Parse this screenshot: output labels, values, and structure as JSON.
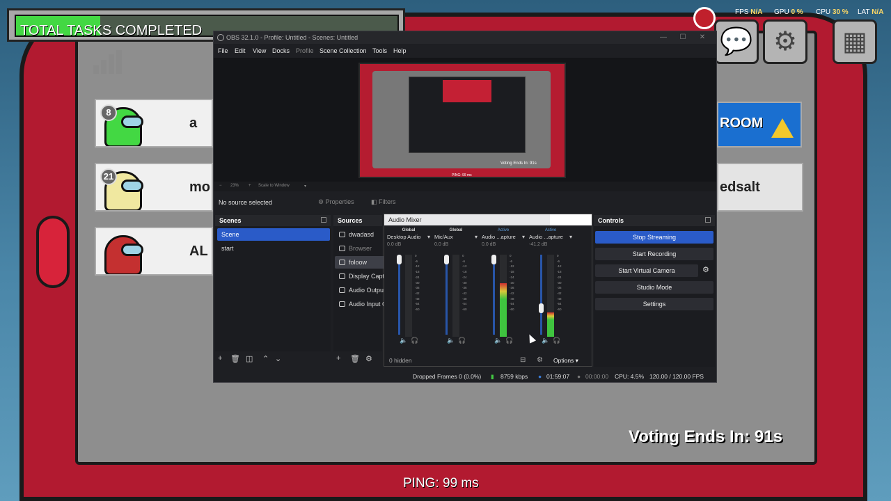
{
  "game": {
    "tasks_label": "TOTAL TASKS COMPLETED",
    "tasks_progress": 0.22,
    "voting_text": "Voting Ends In: 91s",
    "ping_text": "PING: 99 ms",
    "stats": {
      "fps_label": "FPS",
      "fps_value": "N/A",
      "gpu_label": "GPU",
      "gpu_value": "0 %",
      "cpu_label": "CPU",
      "cpu_value": "30 %",
      "lat_label": "LAT",
      "lat_value": "N/A"
    },
    "players": [
      {
        "number": "8",
        "name_fragment": "a",
        "color": "#43d843"
      },
      {
        "number": "21",
        "name_fragment": "mo",
        "color": "#f0e8a0"
      },
      {
        "number": "",
        "name_fragment": "AL",
        "color": "#c43030"
      }
    ],
    "right_cards": [
      {
        "text": "ROOM"
      },
      {
        "text": "edsalt"
      }
    ],
    "icons": {
      "signal": "signal-bars-icon",
      "chat": "chat-bubble-icon",
      "settings": "gear-icon",
      "map": "map-icon",
      "record": "record-dot-icon"
    },
    "accent_colors": {
      "tablet_red": "#b21a30",
      "task_green": "#43d843",
      "obs_blue": "#2a5bc8"
    }
  },
  "obs": {
    "title": "OBS 32.1.0 - Profile: Untitled - Scenes: Untitled",
    "menu": [
      "File",
      "Edit",
      "View",
      "Docks",
      "Profile",
      "Scene Collection",
      "Tools",
      "Help"
    ],
    "zoom": {
      "value": "23%",
      "mode": "Scale to Window"
    },
    "no_source": "No source selected",
    "properties_label": "Properties",
    "filters_label": "Filters",
    "preview": {
      "vote_text": "Voting Ends In: 91s",
      "ping_text": "PING: 99 ms"
    },
    "scenes": {
      "header": "Scenes",
      "items": [
        {
          "label": "Scene",
          "selected": true
        },
        {
          "label": "start",
          "selected": false
        }
      ]
    },
    "sources": {
      "header": "Sources",
      "items": [
        {
          "label": "dwadasd",
          "selected": false,
          "dim": false
        },
        {
          "label": "Browser",
          "selected": false,
          "dim": true
        },
        {
          "label": "foloow",
          "selected": true,
          "dim": false
        },
        {
          "label": "Display Captu",
          "selected": false,
          "dim": false
        },
        {
          "label": "Audio Output",
          "selected": false,
          "dim": false
        },
        {
          "label": "Audio Input C",
          "selected": false,
          "dim": false
        }
      ]
    },
    "mixer": {
      "title": "Audio Mixer",
      "channels": [
        {
          "status": "Global",
          "name": "Desktop Audio",
          "db": "0.0 dB",
          "level": 0.0,
          "fader": 1.0
        },
        {
          "status": "Global",
          "name": "Mic/Aux",
          "db": "0.0 dB",
          "level": 0.0,
          "fader": 1.0
        },
        {
          "status": "Active",
          "name": "Audio ...apture",
          "db": "0.0 dB",
          "level": 0.65,
          "fader": 1.0
        },
        {
          "status": "Active",
          "name": "Audio ...apture",
          "db": "-41.2 dB",
          "level": 0.3,
          "fader": 0.3
        }
      ],
      "scale": [
        "0",
        "-6",
        "-12",
        "-18",
        "-24",
        "-30",
        "-36",
        "-42",
        "-48",
        "-54",
        "-60"
      ],
      "hidden_label": "0 hidden",
      "options_label": "Options"
    },
    "controls": {
      "header": "Controls",
      "stop_streaming": "Stop Streaming",
      "start_recording": "Start Recording",
      "start_virtual_camera": "Start Virtual Camera",
      "studio_mode": "Studio Mode",
      "settings": "Settings"
    },
    "status": {
      "dropped_frames": "Dropped Frames 0 (0.0%)",
      "bitrate": "8759 kbps",
      "stream_time": "01:59:07",
      "rec_time": "00:00:00",
      "cpu": "CPU: 4.5%",
      "fps": "120.00 / 120.00 FPS"
    }
  }
}
